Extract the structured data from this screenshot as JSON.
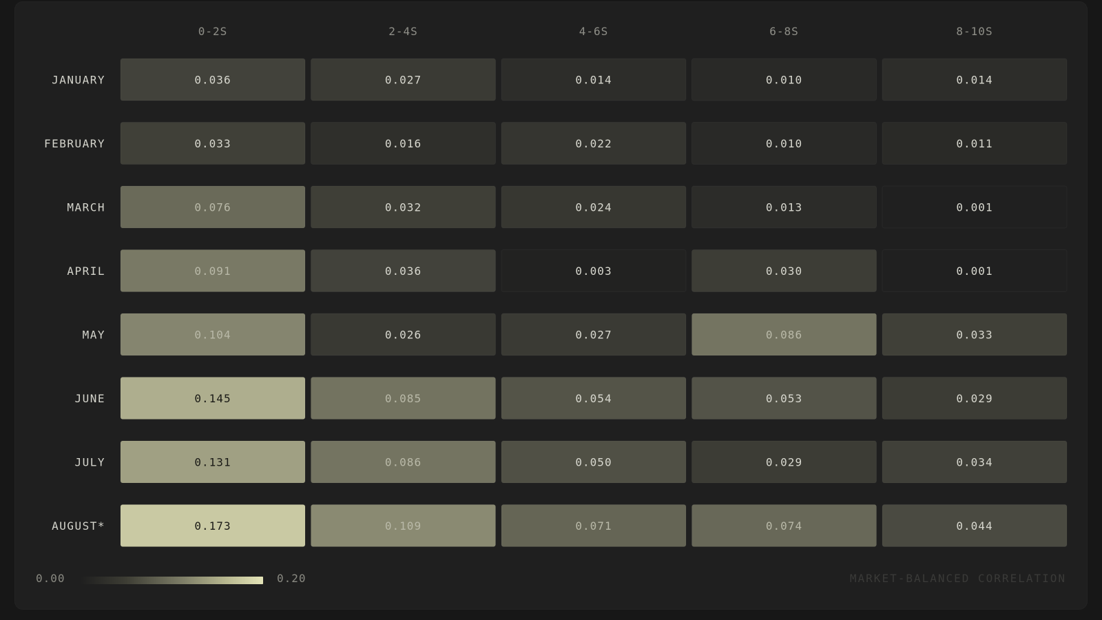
{
  "chart_data": {
    "type": "heatmap",
    "columns": [
      "0-2S",
      "2-4S",
      "4-6S",
      "6-8S",
      "8-10S"
    ],
    "rows": [
      "JANUARY",
      "FEBRUARY",
      "MARCH",
      "APRIL",
      "MAY",
      "JUNE",
      "JULY",
      "AUGUST*"
    ],
    "values": [
      [
        "0.036",
        "0.027",
        "0.014",
        "0.010",
        "0.014"
      ],
      [
        "0.033",
        "0.016",
        "0.022",
        "0.010",
        "0.011"
      ],
      [
        "0.076",
        "0.032",
        "0.024",
        "0.013",
        "0.001"
      ],
      [
        "0.091",
        "0.036",
        "0.003",
        "0.030",
        "0.001"
      ],
      [
        "0.104",
        "0.026",
        "0.027",
        "0.086",
        "0.033"
      ],
      [
        "0.145",
        "0.085",
        "0.054",
        "0.053",
        "0.029"
      ],
      [
        "0.131",
        "0.086",
        "0.050",
        "0.029",
        "0.034"
      ],
      [
        "0.173",
        "0.109",
        "0.071",
        "0.074",
        "0.044"
      ]
    ],
    "scale": {
      "min_label": "0.00",
      "max_label": "0.20",
      "min": 0.0,
      "max": 0.2,
      "colors": [
        "#1f1f1f",
        "#e4e4b8"
      ]
    },
    "annotation": "MARKET-BALANCED CORRELATION"
  }
}
